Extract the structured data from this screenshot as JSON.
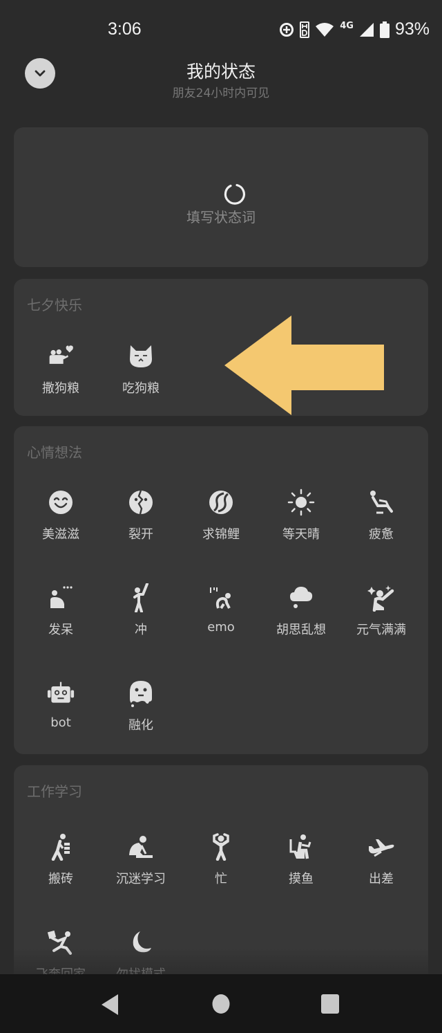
{
  "status_bar": {
    "time": "3:06",
    "icons": [
      "data-saver-icon",
      "hd-icon",
      "wifi-icon",
      "network-4g-icon",
      "signal-icon",
      "battery-icon"
    ],
    "network_label": "4G",
    "battery": "93%"
  },
  "header": {
    "collapse_icon": "chevron-down-icon",
    "title": "我的状态",
    "subtitle": "朋友24小时内可见"
  },
  "status_input": {
    "icon": "loading-ring-icon",
    "placeholder": "填写状态词"
  },
  "sections": [
    {
      "title": "七夕快乐",
      "items": [
        {
          "label": "撒狗粮",
          "icon": "couple-heart-icon"
        },
        {
          "label": "吃狗粮",
          "icon": "grumpy-cat-icon"
        }
      ]
    },
    {
      "title": "心情想法",
      "items": [
        {
          "label": "美滋滋",
          "icon": "smile-face-icon"
        },
        {
          "label": "裂开",
          "icon": "cracked-face-icon"
        },
        {
          "label": "求锦鲤",
          "icon": "koi-fish-icon"
        },
        {
          "label": "等天晴",
          "icon": "sun-icon"
        },
        {
          "label": "疲惫",
          "icon": "reclining-person-icon"
        },
        {
          "label": "发呆",
          "icon": "daydream-person-icon"
        },
        {
          "label": "冲",
          "icon": "charge-person-icon"
        },
        {
          "label": "emo",
          "icon": "sad-crouching-person-icon"
        },
        {
          "label": "胡思乱想",
          "icon": "thought-bubble-icon"
        },
        {
          "label": "元气满满",
          "icon": "sparkle-person-icon"
        },
        {
          "label": "bot",
          "icon": "robot-icon"
        },
        {
          "label": "融化",
          "icon": "melting-face-icon"
        }
      ]
    },
    {
      "title": "工作学习",
      "items": [
        {
          "label": "搬砖",
          "icon": "carry-bricks-icon"
        },
        {
          "label": "沉迷学习",
          "icon": "studying-person-icon"
        },
        {
          "label": "忙",
          "icon": "busy-person-icon"
        },
        {
          "label": "摸鱼",
          "icon": "slacking-toilet-icon"
        },
        {
          "label": "出差",
          "icon": "airplane-icon"
        },
        {
          "label": "飞奔回家",
          "icon": "running-home-icon"
        },
        {
          "label": "勿扰模式",
          "icon": "moon-icon"
        }
      ]
    }
  ],
  "annotation": {
    "type": "arrow",
    "direction": "left",
    "color": "#f4c870"
  },
  "nav_bar": {
    "back": "back-triangle-icon",
    "home": "home-circle-icon",
    "recents": "recents-square-icon"
  }
}
